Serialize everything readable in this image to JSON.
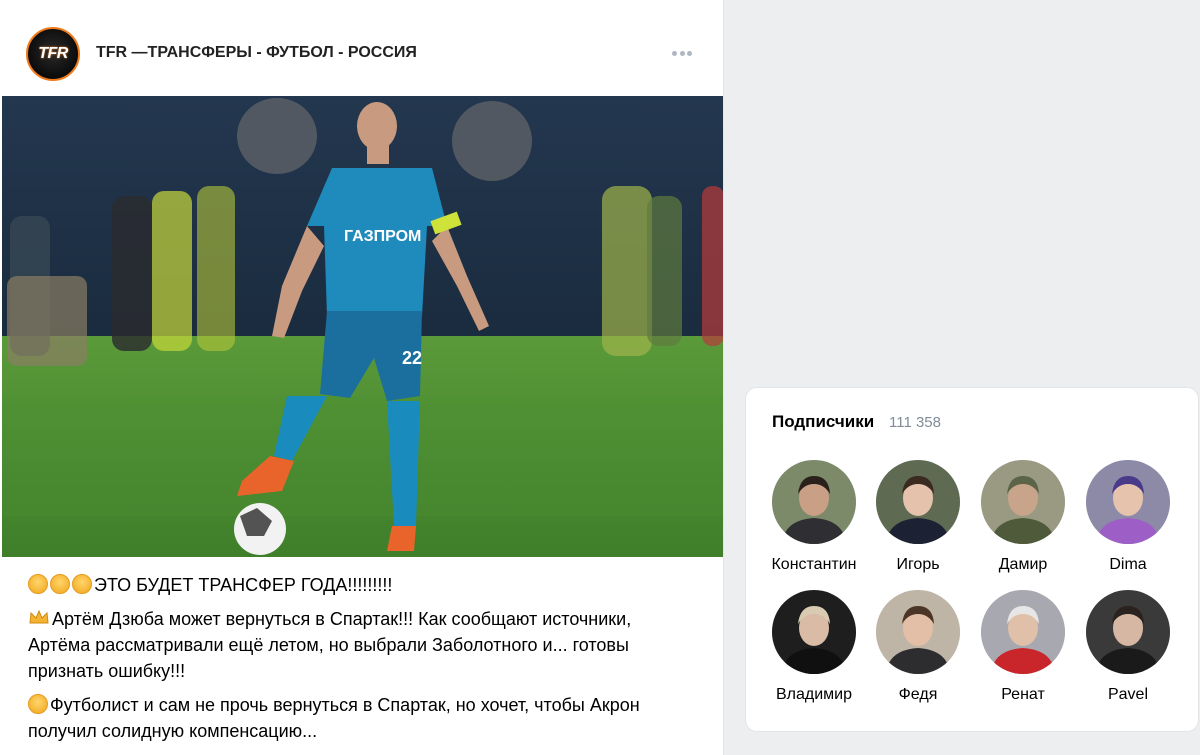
{
  "post": {
    "group_name": "TFR —ТРАНСФЕРЫ - ФУТБОЛ - РОССИЯ",
    "logo_text": "TFR",
    "more_icon": "more-horizontal-icon",
    "photo_texts": {
      "sponsor": "ГАЗПРОМ",
      "number": "22"
    },
    "headline": "ЭТО БУДЕТ ТРАНСФЕР ГОДА!!!!!!!!!",
    "paragraph1": "Артём Дзюба может вернуться в Спартак!!! Как сообщают источники, Артёма рассматривали ещё летом, но выбрали Заболотного и... готовы признать ошибку!!!",
    "paragraph2": "Футболист и сам не прочь вернуться в Спартак, но хочет, чтобы Акрон получил солидную компенсацию..."
  },
  "subscribers": {
    "title": "Подписчики",
    "count": "111 358",
    "people": [
      {
        "name": "Константин",
        "bg": "#7d8a6a",
        "skin": "#c99f86",
        "hair": "#2b211c",
        "cloth": "#2f2f33"
      },
      {
        "name": "Игорь",
        "bg": "#5e6b52",
        "skin": "#e5c2ab",
        "hair": "#3a2a20",
        "cloth": "#1c2233"
      },
      {
        "name": "Дамир",
        "bg": "#9a9a82",
        "skin": "#c8a48a",
        "hair": "#5c6448",
        "cloth": "#4e5a3a"
      },
      {
        "name": "Dima",
        "bg": "#8d8aa8",
        "skin": "#e6c3ad",
        "hair": "#4a3a8a",
        "cloth": "#9d5fc6"
      },
      {
        "name": "Владимир",
        "bg": "#1e1e1e",
        "skin": "#d9bba6",
        "hair": "#d8cbb2",
        "cloth": "#101010"
      },
      {
        "name": "Федя",
        "bg": "#bfb5a6",
        "skin": "#e2bfa6",
        "hair": "#4a3526",
        "cloth": "#2d2d30"
      },
      {
        "name": "Ренат",
        "bg": "#a8a8b0",
        "skin": "#e0c0a8",
        "hair": "#e6e6e6",
        "cloth": "#c8262b"
      },
      {
        "name": "Pavel",
        "bg": "#3a3a3a",
        "skin": "#d6b7a3",
        "hair": "#2a221e",
        "cloth": "#1a1a1a"
      }
    ]
  }
}
